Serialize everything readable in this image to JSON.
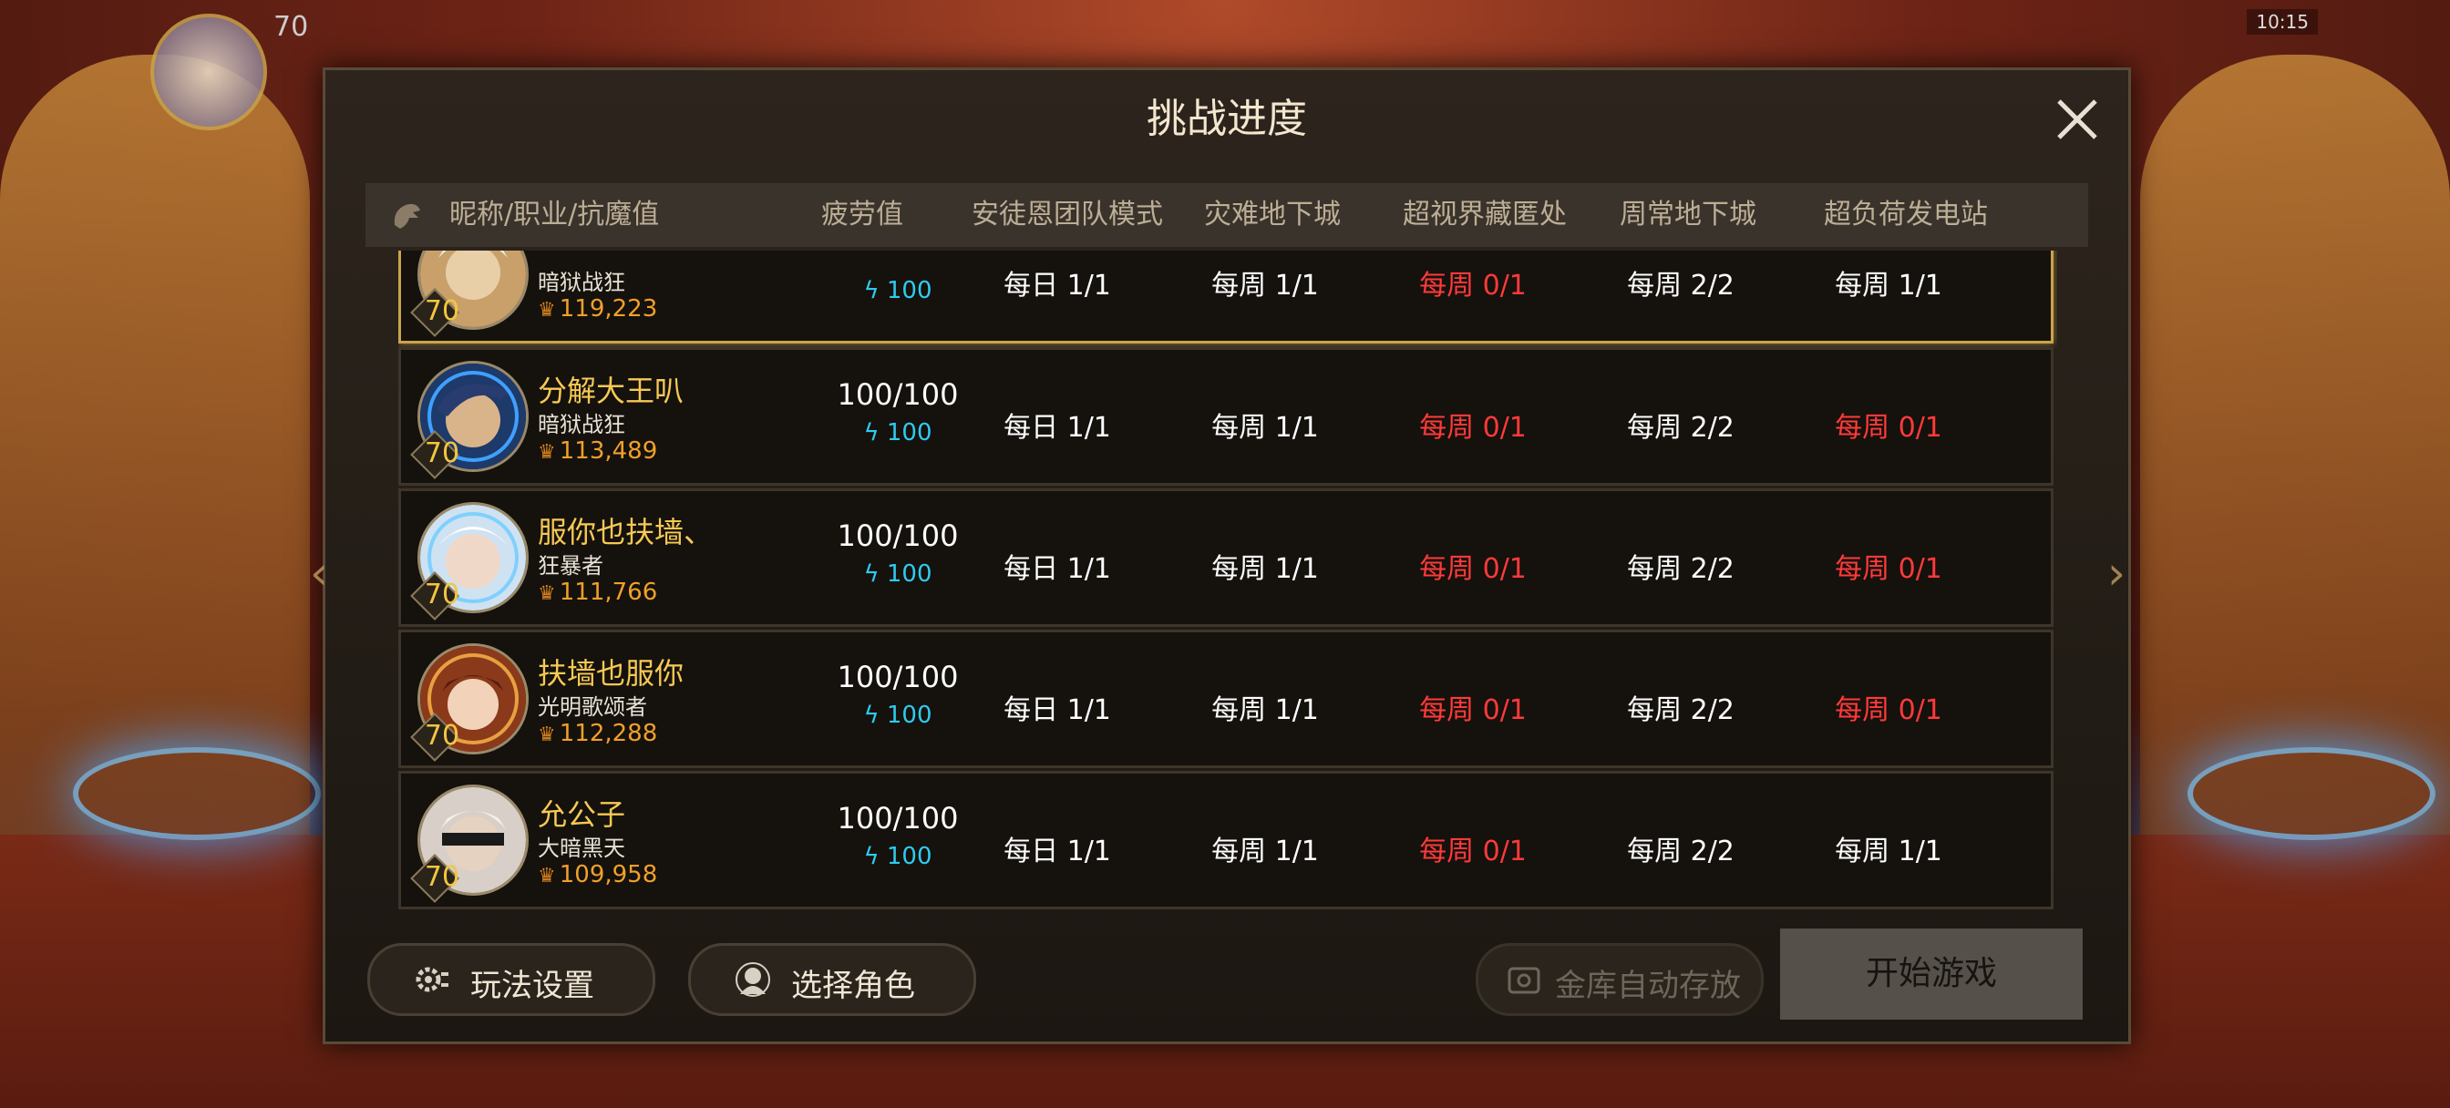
{
  "background": {
    "player_level": "70",
    "status_text": "10:15"
  },
  "modal": {
    "title": "挑战进度",
    "headers": {
      "name": "昵称/职业/抗魔值",
      "fatigue": "疲劳值",
      "col1": "安徒恩团队模式",
      "col2": "灾难地下城",
      "col3": "超视界藏匿处",
      "col4": "周常地下城",
      "col5": "超负荷发电站"
    },
    "rows": [
      {
        "name": "",
        "class": "暗狱战狂",
        "score": "119,223",
        "level": "70",
        "fatigue": "",
        "energy": "100",
        "c1": "每日 1/1",
        "c2": "每周 1/1",
        "c3": "每周 0/1",
        "c4": "每周 2/2",
        "c5": "每周 1/1",
        "c5_red": false
      },
      {
        "name": "分解大王叭",
        "class": "暗狱战狂",
        "score": "113,489",
        "level": "70",
        "fatigue": "100/100",
        "energy": "100",
        "c1": "每日 1/1",
        "c2": "每周 1/1",
        "c3": "每周 0/1",
        "c4": "每周 2/2",
        "c5": "每周 0/1",
        "c5_red": true
      },
      {
        "name": "服你也扶墙、",
        "class": "狂暴者",
        "score": "111,766",
        "level": "70",
        "fatigue": "100/100",
        "energy": "100",
        "c1": "每日 1/1",
        "c2": "每周 1/1",
        "c3": "每周 0/1",
        "c4": "每周 2/2",
        "c5": "每周 0/1",
        "c5_red": true
      },
      {
        "name": "扶墙也服你",
        "class": "光明歌颂者",
        "score": "112,288",
        "level": "70",
        "fatigue": "100/100",
        "energy": "100",
        "c1": "每日 1/1",
        "c2": "每周 1/1",
        "c3": "每周 0/1",
        "c4": "每周 2/2",
        "c5": "每周 0/1",
        "c5_red": true
      },
      {
        "name": "允公子",
        "class": "大暗黑天",
        "score": "109,958",
        "level": "70",
        "fatigue": "100/100",
        "energy": "100",
        "c1": "每日 1/1",
        "c2": "每周 1/1",
        "c3": "每周 0/1",
        "c4": "每周 2/2",
        "c5": "每周 1/1",
        "c5_red": false
      }
    ],
    "buttons": {
      "settings": "玩法设置",
      "select_role": "选择角色",
      "vault": "金库自动存放",
      "start": "开始游戏"
    },
    "colors": {
      "accent_gold": "#f6c955",
      "red": "#ff3a3a",
      "energy_blue": "#2ecbf0"
    }
  }
}
